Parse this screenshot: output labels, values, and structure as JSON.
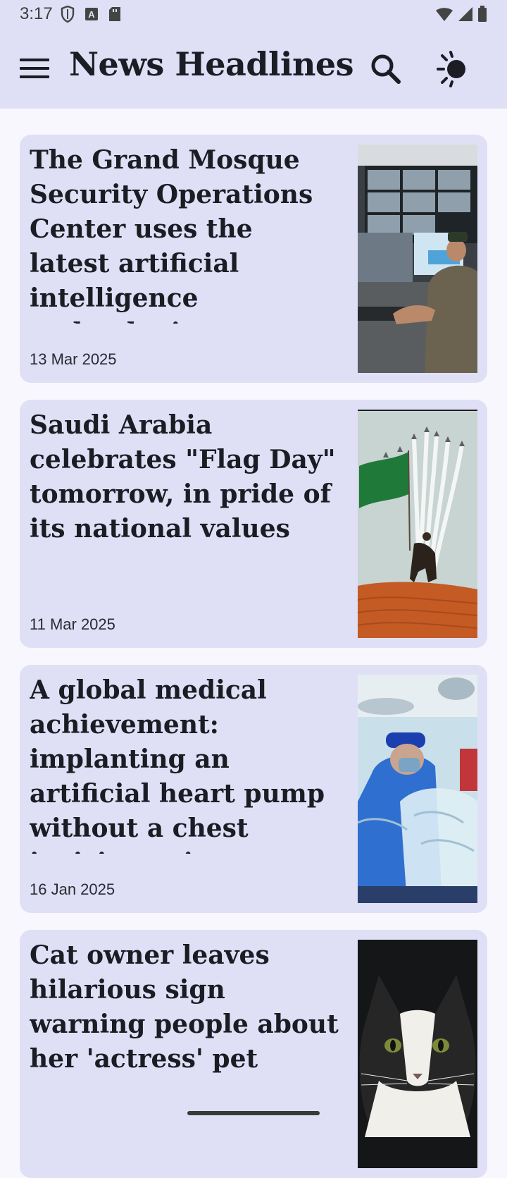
{
  "status_bar": {
    "time": "3:17"
  },
  "app_bar": {
    "title": "News Headlines"
  },
  "articles": [
    {
      "title": "The Grand Mosque Security Operations Center uses the latest artificial intelligence technologies",
      "date": "13 Mar 2025",
      "image": "security-control-room-photo"
    },
    {
      "title": "Saudi Arabia celebrates \"Flag Day\" tomorrow, in pride of its national values",
      "date": "11 Mar 2025",
      "image": "saudi-flag-rider-photo"
    },
    {
      "title": "A global medical achievement: implanting an artificial heart pump without a chest incision using a robot",
      "date": "16 Jan 2025",
      "image": "robotic-surgery-photo"
    },
    {
      "title": "Cat owner leaves hilarious sign warning people about her 'actress' pet",
      "date": "",
      "image": "black-white-cat-photo"
    }
  ],
  "icons": {
    "menu": "hamburger-menu-icon",
    "search": "search-icon",
    "theme": "theme-toggle-icon"
  },
  "colors": {
    "app_bar_bg": "#dfe0f5",
    "card_bg": "#dfe0f5",
    "page_bg": "#f7f7fd",
    "text": "#1c1c24"
  }
}
